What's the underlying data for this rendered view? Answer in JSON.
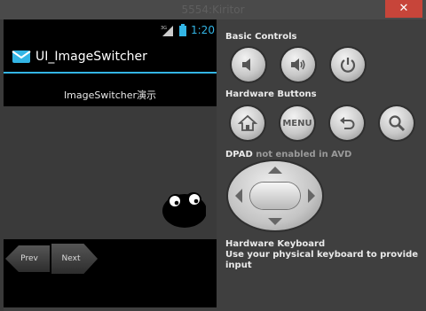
{
  "window": {
    "title": "5554:Kiritor",
    "close_glyph": "✕"
  },
  "status_bar": {
    "time": "1:20",
    "signal": "3G",
    "accent": "#33b5e5"
  },
  "action_bar": {
    "title": "UI_ImageSwitcher",
    "icon": "mail-icon"
  },
  "content": {
    "subtitle": "ImageSwitcher演示"
  },
  "nav_buttons": {
    "prev_label": "Prev",
    "next_label": "Next"
  },
  "controls": {
    "basic_controls_title": "Basic Controls",
    "basic_buttons": [
      "volume-down-icon",
      "volume-up-icon",
      "power-icon"
    ],
    "hardware_buttons_title": "Hardware Buttons",
    "hardware_buttons": [
      "home-icon",
      "menu-button",
      "back-icon",
      "search-icon"
    ],
    "menu_label": "MENU",
    "dpad_title": "DPAD",
    "dpad_note": "not enabled in AVD",
    "keyboard_title": "Hardware Keyboard",
    "keyboard_note": "Use your physical keyboard to provide input"
  }
}
